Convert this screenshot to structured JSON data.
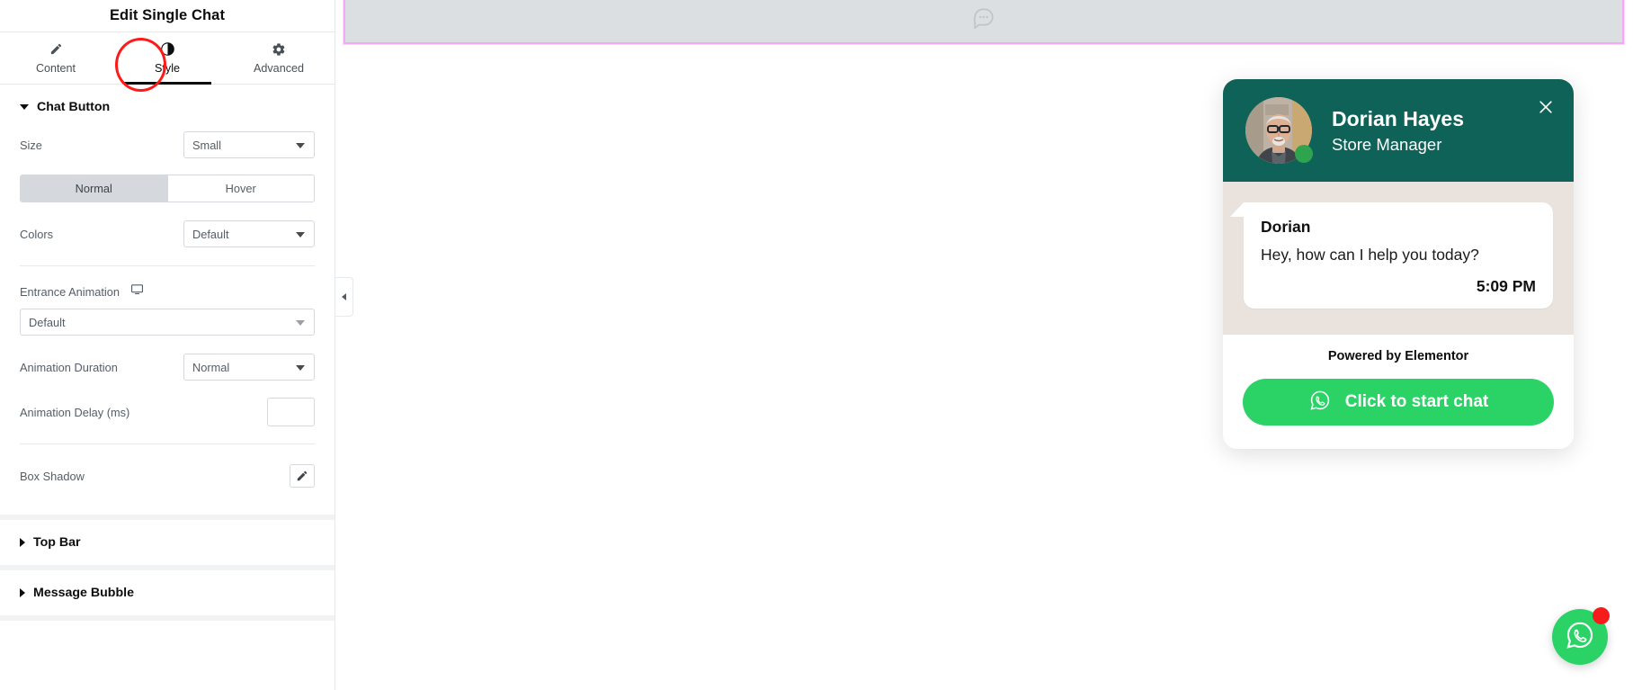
{
  "panel": {
    "title": "Edit Single Chat",
    "tabs": [
      {
        "label": "Content",
        "icon": "pencil-icon",
        "active": false
      },
      {
        "label": "Style",
        "icon": "contrast-icon",
        "active": true
      },
      {
        "label": "Advanced",
        "icon": "gear-icon",
        "active": false
      }
    ],
    "sections": {
      "chat_button": {
        "title": "Chat Button",
        "expanded": true,
        "size": {
          "label": "Size",
          "value": "Small"
        },
        "state_tabs": {
          "normal": "Normal",
          "hover": "Hover",
          "active": "Normal"
        },
        "colors": {
          "label": "Colors",
          "value": "Default"
        },
        "entrance_animation": {
          "label": "Entrance Animation",
          "value": "Default",
          "device_icon": "desktop-icon"
        },
        "animation_duration": {
          "label": "Animation Duration",
          "value": "Normal"
        },
        "animation_delay": {
          "label": "Animation Delay (ms)",
          "value": "",
          "placeholder": ""
        },
        "box_shadow": {
          "label": "Box Shadow",
          "edit_icon": "pencil-icon"
        }
      },
      "top_bar": {
        "title": "Top Bar",
        "expanded": false
      },
      "message_bubble": {
        "title": "Message Bubble",
        "expanded": false
      }
    },
    "collapse_handle": "chevron-left-icon"
  },
  "canvas": {
    "selected_element": {
      "icon": "chat-bubble-dots-icon",
      "border_color": "#f5a9f5"
    },
    "chat_widget": {
      "header": {
        "name": "Dorian Hayes",
        "role": "Store Manager",
        "avatar": "person-photo-avatar",
        "online_status": "online",
        "close_icon": "close-icon",
        "background_color": "#0f6258"
      },
      "messages": [
        {
          "sender": "Dorian",
          "text": "Hey, how can I help you today?",
          "time": "5:09 PM"
        }
      ],
      "footer": {
        "powered_by": "Powered by Elementor",
        "cta_label": "Click to start chat",
        "cta_icon": "whatsapp-icon",
        "cta_color": "#2bd366"
      }
    },
    "floating_button": {
      "icon": "whatsapp-icon",
      "color": "#2bd366",
      "badge": true,
      "badge_color": "#f81b1b"
    }
  }
}
